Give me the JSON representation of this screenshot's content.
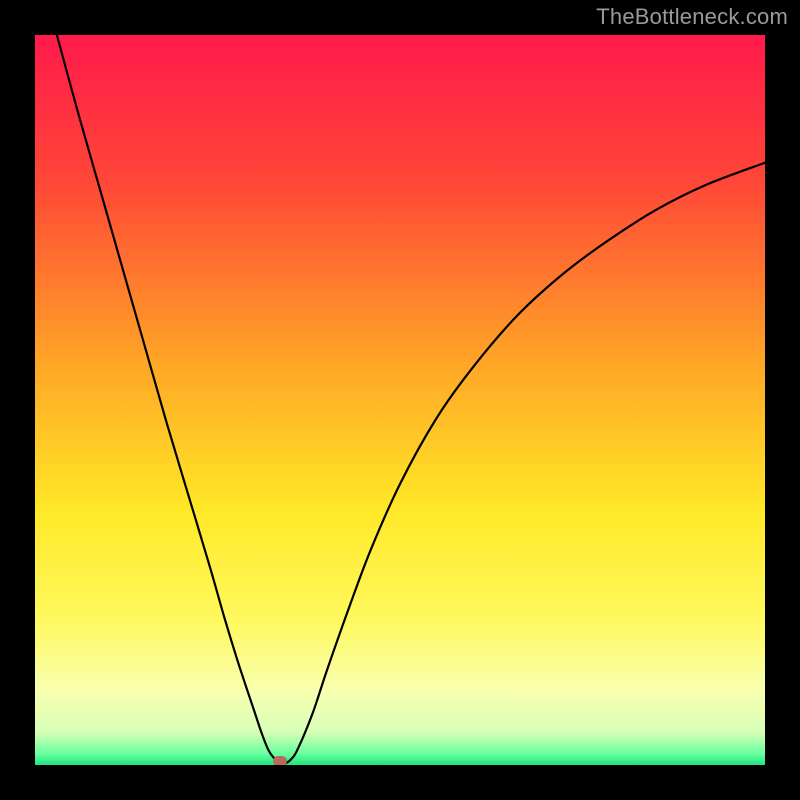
{
  "watermark": "TheBottleneck.com",
  "chart_data": {
    "type": "line",
    "title": "",
    "xlabel": "",
    "ylabel": "",
    "xlim": [
      0,
      100
    ],
    "ylim": [
      0,
      100
    ],
    "gradient_stops": [
      {
        "offset": 0,
        "color": "#ff1a4b"
      },
      {
        "offset": 0.2,
        "color": "#ff4637"
      },
      {
        "offset": 0.45,
        "color": "#ffa626"
      },
      {
        "offset": 0.65,
        "color": "#ffe826"
      },
      {
        "offset": 0.8,
        "color": "#fff95e"
      },
      {
        "offset": 0.9,
        "color": "#f8ffb0"
      },
      {
        "offset": 0.955,
        "color": "#d7ffb8"
      },
      {
        "offset": 0.985,
        "color": "#66ff9e"
      },
      {
        "offset": 1.0,
        "color": "#21e27d"
      }
    ],
    "series": [
      {
        "name": "bottleneck-curve",
        "x": [
          3,
          6,
          9,
          12,
          15,
          18,
          21,
          24,
          26,
          28,
          30,
          31,
          32,
          33,
          34,
          35,
          36,
          38,
          40,
          43,
          46,
          50,
          55,
          60,
          66,
          72,
          78,
          85,
          92,
          100
        ],
        "y": [
          100,
          89,
          78.5,
          68,
          57.5,
          47,
          37,
          27,
          20,
          13.5,
          7.5,
          4.5,
          2,
          0.7,
          0.2,
          0.7,
          2.2,
          7,
          13,
          21.5,
          29.5,
          38.5,
          47.5,
          54.5,
          61.5,
          67,
          71.5,
          76,
          79.5,
          82.5
        ]
      }
    ],
    "marker": {
      "x": 33.5,
      "y": 0.6,
      "color": "#b7695b"
    }
  }
}
